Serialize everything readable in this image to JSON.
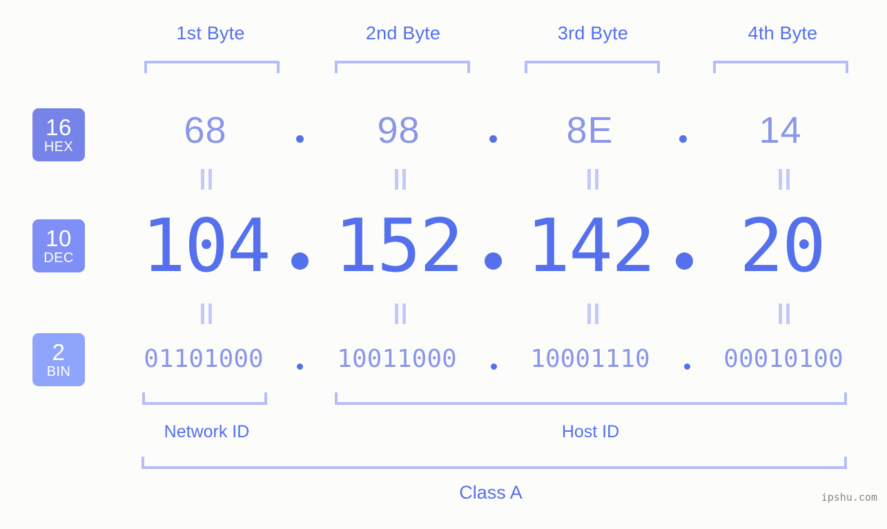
{
  "meta": {
    "background_color": "#fcfdfa",
    "accent_color": "#5470ed",
    "accent_light_color": "#8a97e8",
    "bracket_color": "#b4bdfb",
    "watermark": "ipshu.com"
  },
  "byte_headers": [
    {
      "label": "1st Byte"
    },
    {
      "label": "2nd Byte"
    },
    {
      "label": "3rd Byte"
    },
    {
      "label": "4th Byte"
    }
  ],
  "rows": [
    {
      "badge_num": "16",
      "badge_name": "HEX",
      "badge_color": "#7684ea",
      "values": [
        "68",
        "98",
        "8E",
        "14"
      ],
      "separator": "."
    },
    {
      "badge_num": "10",
      "badge_name": "DEC",
      "badge_color": "#808ff5",
      "values": [
        "104",
        "152",
        "142",
        "20"
      ],
      "separator": "."
    },
    {
      "badge_num": "2",
      "badge_name": "BIN",
      "badge_color": "#8fa4fb",
      "values": [
        "01101000",
        "10011000",
        "10001110",
        "00010100"
      ],
      "separator": "."
    }
  ],
  "equals_symbol": "||",
  "sections": [
    {
      "label": "Network ID"
    },
    {
      "label": "Host ID"
    }
  ],
  "class": {
    "label": "Class A"
  }
}
